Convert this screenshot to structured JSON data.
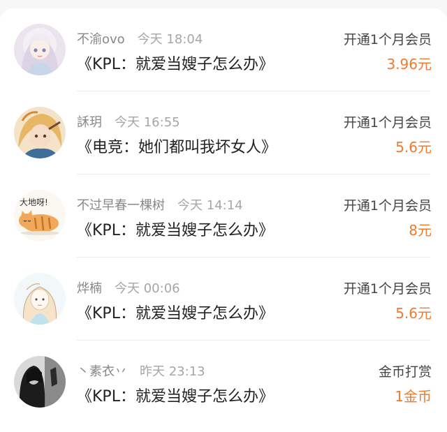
{
  "colors": {
    "accent_amount": "#f07a2e",
    "background": "#f6f6f6",
    "card": "#ffffff"
  },
  "records": [
    {
      "username": "不渝ovo",
      "time": "今天 18:04",
      "book_title": "《KPL：就爱当嫂子怎么办》",
      "action": "开通1个月会员",
      "amount": "3.96元",
      "avatar_icon": "anime-girl-white-hair-avatar"
    },
    {
      "username": "訸玥",
      "time": "今天 16:55",
      "book_title": "《电竞：她们都叫我坏女人》",
      "action": "开通1个月会员",
      "amount": "5.6元",
      "avatar_icon": "anime-blonde-character-avatar"
    },
    {
      "username": "不过早春一棵树",
      "time": "今天 14:14",
      "book_title": "《KPL：就爱当嫂子怎么办》",
      "action": "开通1个月会员",
      "amount": "8元",
      "avatar_icon": "cartoon-cat-avatar",
      "avatar_text": "大地呀!"
    },
    {
      "username": "烨楠",
      "time": "今天 00:06",
      "book_title": "《KPL：就爱当嫂子怎么办》",
      "action": "开通1个月会员",
      "amount": "5.6元",
      "avatar_icon": "sketch-girl-avatar"
    },
    {
      "username": "丶素衣丷",
      "time": "昨天 23:13",
      "book_title": "《KPL：就爱当嫂子怎么办》",
      "action": "金币打赏",
      "amount": "1金币",
      "avatar_icon": "dark-photo-girl-avatar"
    }
  ]
}
